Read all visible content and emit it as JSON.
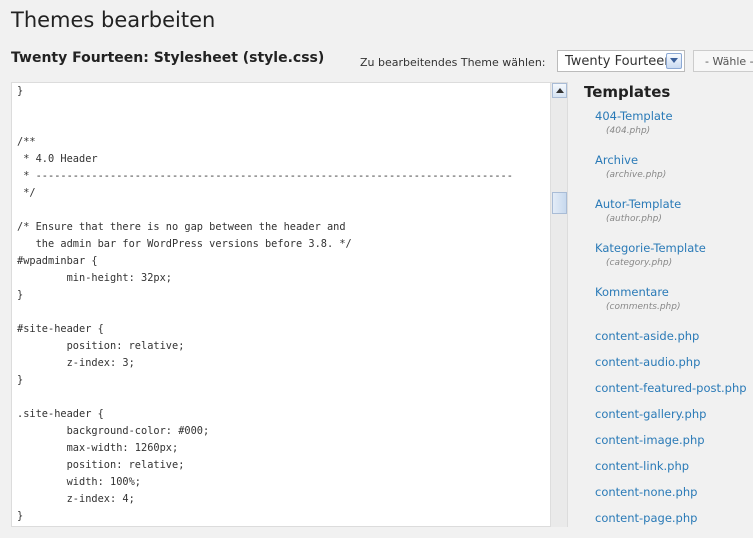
{
  "page": {
    "title": "Themes bearbeiten",
    "file_title": "Twenty Fourteen: Stylesheet (style.css)"
  },
  "theme_select": {
    "label": "Zu bearbeitendes Theme wählen:",
    "selected": "Twenty Fourteen",
    "button_label": "- Wähle -"
  },
  "editor": {
    "code": "}\n\n\n/**\n * 4.0 Header\n * -----------------------------------------------------------------------------\n */\n\n/* Ensure that there is no gap between the header and\n   the admin bar for WordPress versions before 3.8. */\n#wpadminbar {\n\tmin-height: 32px;\n}\n\n#site-header {\n\tposition: relative;\n\tz-index: 3;\n}\n\n.site-header {\n\tbackground-color: #000;\n\tmax-width: 1260px;\n\tposition: relative;\n\twidth: 100%;\n\tz-index: 4;\n}"
  },
  "templates": {
    "heading": "Templates",
    "items": [
      {
        "label": "404-Template",
        "file": "(404.php)"
      },
      {
        "label": "Archive",
        "file": "(archive.php)"
      },
      {
        "label": "Autor-Template",
        "file": "(author.php)"
      },
      {
        "label": "Kategorie-Template",
        "file": "(category.php)"
      },
      {
        "label": "Kommentare",
        "file": "(comments.php)"
      },
      {
        "label": "content-aside.php",
        "file": ""
      },
      {
        "label": "content-audio.php",
        "file": ""
      },
      {
        "label": "content-featured-post.php",
        "file": ""
      },
      {
        "label": "content-gallery.php",
        "file": ""
      },
      {
        "label": "content-image.php",
        "file": ""
      },
      {
        "label": "content-link.php",
        "file": ""
      },
      {
        "label": "content-none.php",
        "file": ""
      },
      {
        "label": "content-page.php",
        "file": ""
      }
    ]
  },
  "icons": {
    "select_arrow": "chevron-down-icon",
    "scroll_up": "arrow-up-icon"
  }
}
